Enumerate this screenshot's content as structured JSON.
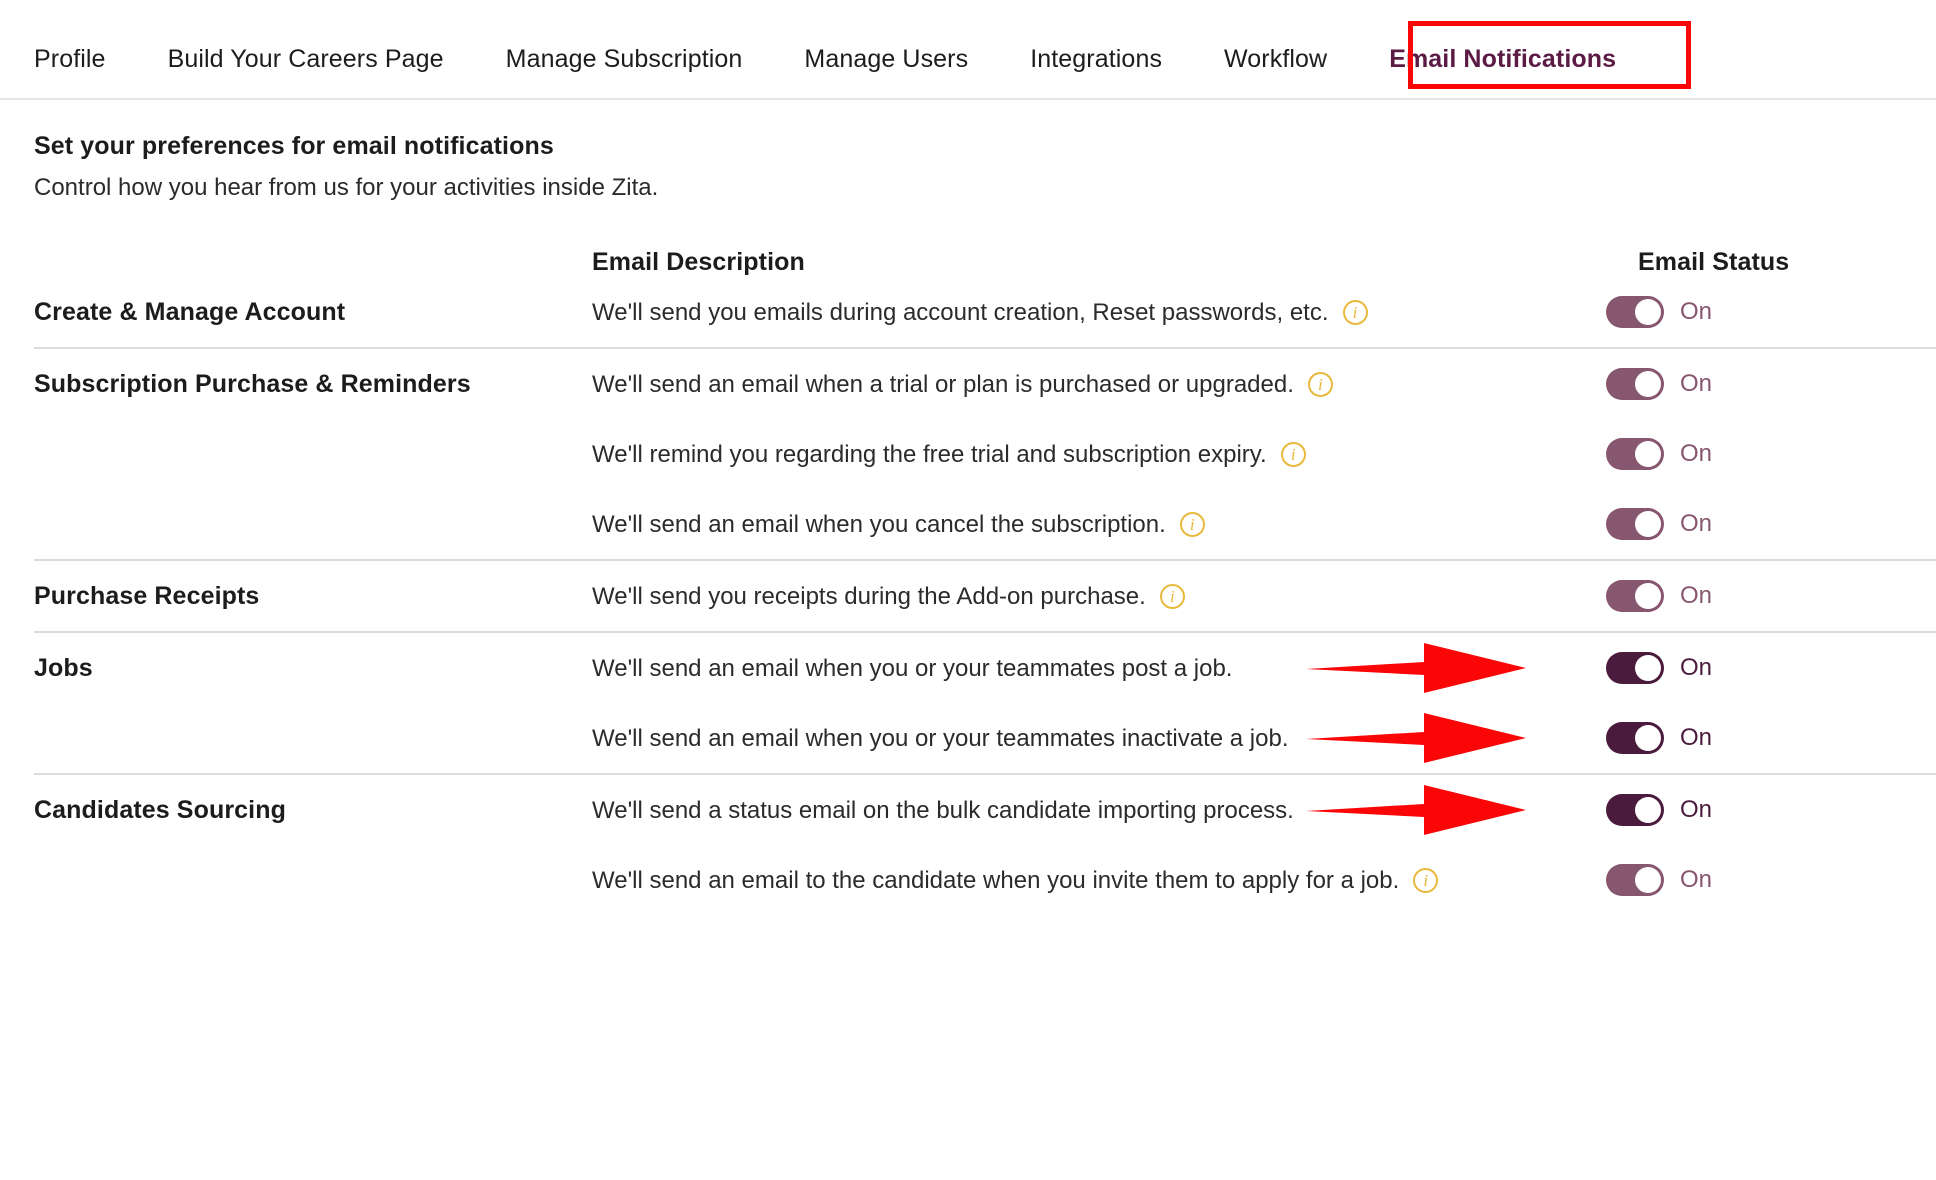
{
  "tabs": [
    {
      "label": "Profile",
      "active": false
    },
    {
      "label": "Build Your Careers Page",
      "active": false
    },
    {
      "label": "Manage Subscription",
      "active": false
    },
    {
      "label": "Manage Users",
      "active": false
    },
    {
      "label": "Integrations",
      "active": false
    },
    {
      "label": "Workflow",
      "active": false
    },
    {
      "label": "Email Notifications",
      "active": true
    }
  ],
  "heading": {
    "title": "Set your preferences for email notifications",
    "subtitle": "Control how you hear from us for your activities inside Zita."
  },
  "columns": {
    "category": "",
    "description": "Email Description",
    "status": "Email Status"
  },
  "colors": {
    "accent_purple": "#5b1b45",
    "toggle_on": "#87566f",
    "toggle_on_dark": "#4b1b3d",
    "annotation_red": "#fb0606",
    "info_gold": "#e8b93c",
    "divider": "#dcdcdc"
  },
  "sections": [
    {
      "category": "Create & Manage Account",
      "rows": [
        {
          "description": "We'll send you emails during account creation, Reset passwords, etc.",
          "has_info": true,
          "status": "On",
          "toggle_on": true,
          "highlighted": false,
          "arrow": false
        }
      ]
    },
    {
      "category": "Subscription Purchase & Reminders",
      "rows": [
        {
          "description": "We'll send an email when a trial or plan is purchased or upgraded.",
          "has_info": true,
          "status": "On",
          "toggle_on": true,
          "highlighted": false,
          "arrow": false
        },
        {
          "description": "We'll remind you regarding the free trial and subscription expiry.",
          "has_info": true,
          "status": "On",
          "toggle_on": true,
          "highlighted": false,
          "arrow": false
        },
        {
          "description": "We'll send an email when you cancel the subscription.",
          "has_info": true,
          "status": "On",
          "toggle_on": true,
          "highlighted": false,
          "arrow": false
        }
      ]
    },
    {
      "category": "Purchase Receipts",
      "rows": [
        {
          "description": "We'll send you receipts during the Add-on purchase.",
          "has_info": true,
          "status": "On",
          "toggle_on": true,
          "highlighted": false,
          "arrow": false
        }
      ]
    },
    {
      "category": "Jobs",
      "rows": [
        {
          "description": "We'll send an email when you or your teammates post a job.",
          "has_info": false,
          "status": "On",
          "toggle_on": true,
          "highlighted": true,
          "arrow": true
        },
        {
          "description": "We'll send an email when you or your teammates inactivate a job.",
          "has_info": false,
          "status": "On",
          "toggle_on": true,
          "highlighted": true,
          "arrow": true
        }
      ]
    },
    {
      "category": "Candidates Sourcing",
      "rows": [
        {
          "description": "We'll send a status email on the bulk candidate importing process.",
          "has_info": false,
          "status": "On",
          "toggle_on": true,
          "highlighted": true,
          "arrow": true
        },
        {
          "description": "We'll send an email to the candidate when you invite them to apply for a job.",
          "has_info": true,
          "status": "On",
          "toggle_on": true,
          "highlighted": false,
          "arrow": false
        }
      ]
    }
  ]
}
